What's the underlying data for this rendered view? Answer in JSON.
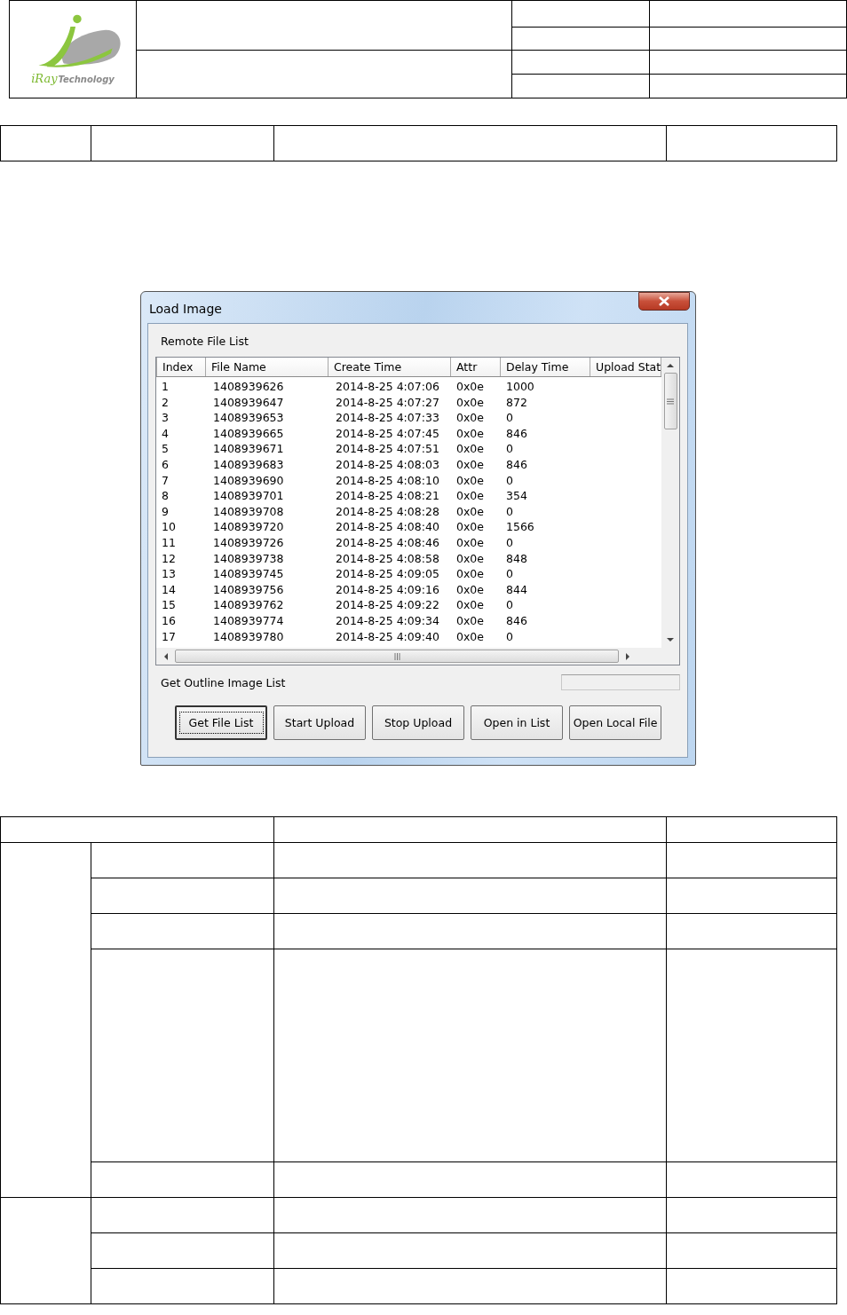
{
  "logo": {
    "brand": "iRay",
    "tagline": "Technology"
  },
  "dialog": {
    "title": "Load Image",
    "group_label": "Remote File List",
    "columns": [
      "Index",
      "File Name",
      "Create Time",
      "Attr",
      "Delay Time",
      "Upload Stat"
    ],
    "rows": [
      {
        "index": "1",
        "file_name": "1408939626",
        "create_time": "2014-8-25 4:07:06",
        "attr": "0x0e",
        "delay_time": "1000"
      },
      {
        "index": "2",
        "file_name": "1408939647",
        "create_time": "2014-8-25 4:07:27",
        "attr": "0x0e",
        "delay_time": "872"
      },
      {
        "index": "3",
        "file_name": "1408939653",
        "create_time": "2014-8-25 4:07:33",
        "attr": "0x0e",
        "delay_time": "0"
      },
      {
        "index": "4",
        "file_name": "1408939665",
        "create_time": "2014-8-25 4:07:45",
        "attr": "0x0e",
        "delay_time": "846"
      },
      {
        "index": "5",
        "file_name": "1408939671",
        "create_time": "2014-8-25 4:07:51",
        "attr": "0x0e",
        "delay_time": "0"
      },
      {
        "index": "6",
        "file_name": "1408939683",
        "create_time": "2014-8-25 4:08:03",
        "attr": "0x0e",
        "delay_time": "846"
      },
      {
        "index": "7",
        "file_name": "1408939690",
        "create_time": "2014-8-25 4:08:10",
        "attr": "0x0e",
        "delay_time": "0"
      },
      {
        "index": "8",
        "file_name": "1408939701",
        "create_time": "2014-8-25 4:08:21",
        "attr": "0x0e",
        "delay_time": "354"
      },
      {
        "index": "9",
        "file_name": "1408939708",
        "create_time": "2014-8-25 4:08:28",
        "attr": "0x0e",
        "delay_time": "0"
      },
      {
        "index": "10",
        "file_name": "1408939720",
        "create_time": "2014-8-25 4:08:40",
        "attr": "0x0e",
        "delay_time": "1566"
      },
      {
        "index": "11",
        "file_name": "1408939726",
        "create_time": "2014-8-25 4:08:46",
        "attr": "0x0e",
        "delay_time": "0"
      },
      {
        "index": "12",
        "file_name": "1408939738",
        "create_time": "2014-8-25 4:08:58",
        "attr": "0x0e",
        "delay_time": "848"
      },
      {
        "index": "13",
        "file_name": "1408939745",
        "create_time": "2014-8-25 4:09:05",
        "attr": "0x0e",
        "delay_time": "0"
      },
      {
        "index": "14",
        "file_name": "1408939756",
        "create_time": "2014-8-25 4:09:16",
        "attr": "0x0e",
        "delay_time": "844"
      },
      {
        "index": "15",
        "file_name": "1408939762",
        "create_time": "2014-8-25 4:09:22",
        "attr": "0x0e",
        "delay_time": "0"
      },
      {
        "index": "16",
        "file_name": "1408939774",
        "create_time": "2014-8-25 4:09:34",
        "attr": "0x0e",
        "delay_time": "846"
      },
      {
        "index": "17",
        "file_name": "1408939780",
        "create_time": "2014-8-25 4:09:40",
        "attr": "0x0e",
        "delay_time": "0"
      }
    ],
    "status_label": "Get Outline Image List",
    "buttons": [
      {
        "label": "Get File List",
        "focused": true
      },
      {
        "label": "Start Upload",
        "focused": false
      },
      {
        "label": "Stop Upload",
        "focused": false
      },
      {
        "label": "Open in List",
        "focused": false
      },
      {
        "label": "Open Local File",
        "focused": false
      }
    ]
  }
}
